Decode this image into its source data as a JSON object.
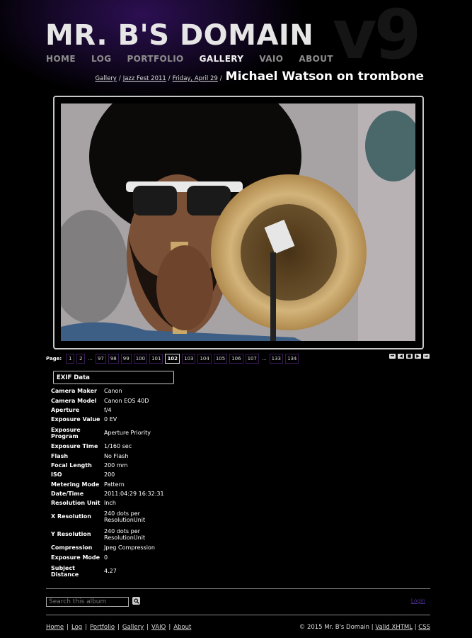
{
  "site": {
    "title": "MR. B'S DOMAIN",
    "version_mark": "v9"
  },
  "nav": {
    "items": [
      {
        "label": "HOME",
        "active": false
      },
      {
        "label": "LOG",
        "active": false
      },
      {
        "label": "PORTFOLIO",
        "active": false
      },
      {
        "label": "GALLERY",
        "active": true
      },
      {
        "label": "VAIO",
        "active": false
      },
      {
        "label": "ABOUT",
        "active": false
      }
    ]
  },
  "breadcrumb": {
    "links": [
      "Gallery",
      "Jazz Fest 2011",
      "Friday, April 29"
    ],
    "separator": "/",
    "current": "Michael Watson on trombone"
  },
  "pager": {
    "label": "Page:",
    "items": [
      "1",
      "2",
      "...",
      "97",
      "98",
      "99",
      "100",
      "101",
      "102",
      "103",
      "104",
      "105",
      "106",
      "107",
      "...",
      "133",
      "134"
    ],
    "current": "102"
  },
  "nav_arrows": [
    "first-page-icon",
    "prev-page-icon",
    "slideshow-icon",
    "next-page-icon",
    "last-page-icon"
  ],
  "exif": {
    "title": "EXIF Data",
    "rows": [
      {
        "key": "Camera Maker",
        "value": "Canon"
      },
      {
        "key": "Camera Model",
        "value": "Canon EOS 40D"
      },
      {
        "key": "Aperture",
        "value": "f/4"
      },
      {
        "key": "Exposure Value",
        "value": "0 EV"
      },
      {
        "key": "Exposure Program",
        "value": "Aperture Priority"
      },
      {
        "key": "Exposure Time",
        "value": "1/160 sec"
      },
      {
        "key": "Flash",
        "value": "No Flash"
      },
      {
        "key": "Focal Length",
        "value": "200 mm"
      },
      {
        "key": "ISO",
        "value": "200"
      },
      {
        "key": "Metering Mode",
        "value": "Pattern"
      },
      {
        "key": "Date/Time",
        "value": "2011:04:29 16:32:31"
      },
      {
        "key": "Resolution Unit",
        "value": "Inch"
      },
      {
        "key": "X Resolution",
        "value": "240 dots per ResolutionUnit"
      },
      {
        "key": "Y Resolution",
        "value": "240 dots per ResolutionUnit"
      },
      {
        "key": "Compression",
        "value": "Jpeg Compression"
      },
      {
        "key": "Exposure Mode",
        "value": "0"
      },
      {
        "key": "Subject Distance",
        "value": "4.27"
      }
    ]
  },
  "search": {
    "placeholder": "Search this album"
  },
  "login": {
    "label": "Login"
  },
  "footer": {
    "links": [
      "Home",
      "Log",
      "Portfolio",
      "Gallery",
      "VAIO",
      "About"
    ],
    "copyright": "© 2015 Mr. B's Domain",
    "valid_xhtml": "Valid XHTML",
    "css": "CSS"
  },
  "colors": {
    "background": "#000000",
    "header_glow": "#2c0f52",
    "login_link": "#4b2d8f",
    "pager_border": "#3a1a55"
  }
}
